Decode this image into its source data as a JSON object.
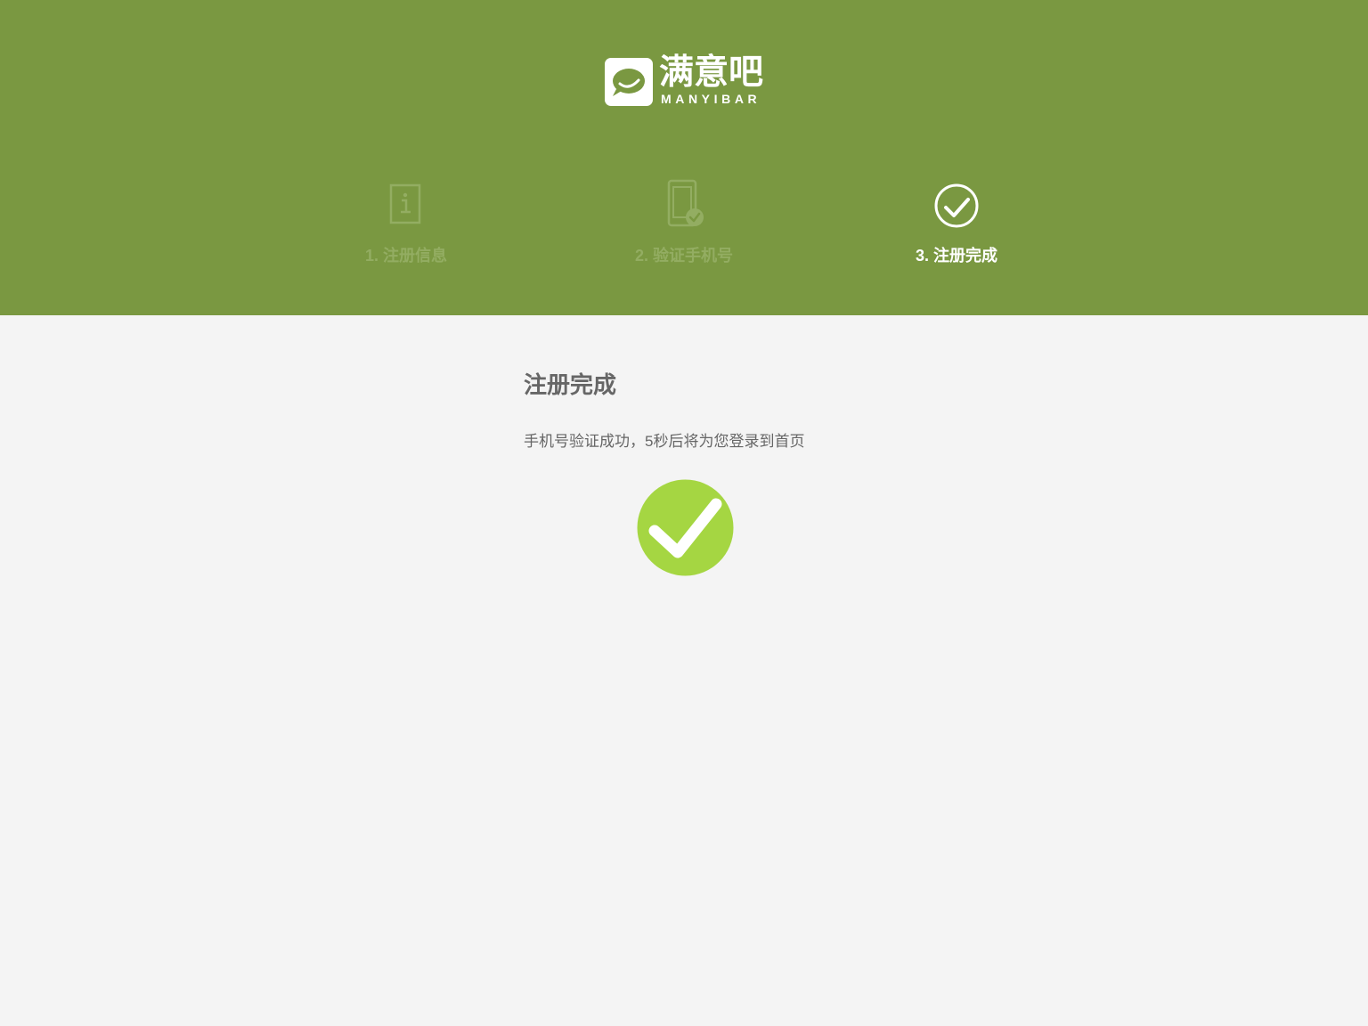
{
  "brand": {
    "name_cn": "满意吧",
    "name_en": "MANYIBAR",
    "logo_icon": "speech-bubble-smile-icon"
  },
  "steps": [
    {
      "label": "1. 注册信息",
      "icon": "info-icon",
      "state": "done"
    },
    {
      "label": "2. 验证手机号",
      "icon": "phone-check-icon",
      "state": "done"
    },
    {
      "label": "3. 注册完成",
      "icon": "circle-check-icon",
      "state": "active"
    }
  ],
  "main": {
    "title": "注册完成",
    "message": "手机号验证成功，5秒后将为您登录到首页",
    "success_icon": "success-check-icon"
  },
  "colors": {
    "header_bg": "#7a9841",
    "page_bg": "#f4f4f4",
    "step_inactive": "#93ad62",
    "step_active": "#ffffff",
    "success_green": "#a5d642",
    "text_gray": "#666666"
  }
}
